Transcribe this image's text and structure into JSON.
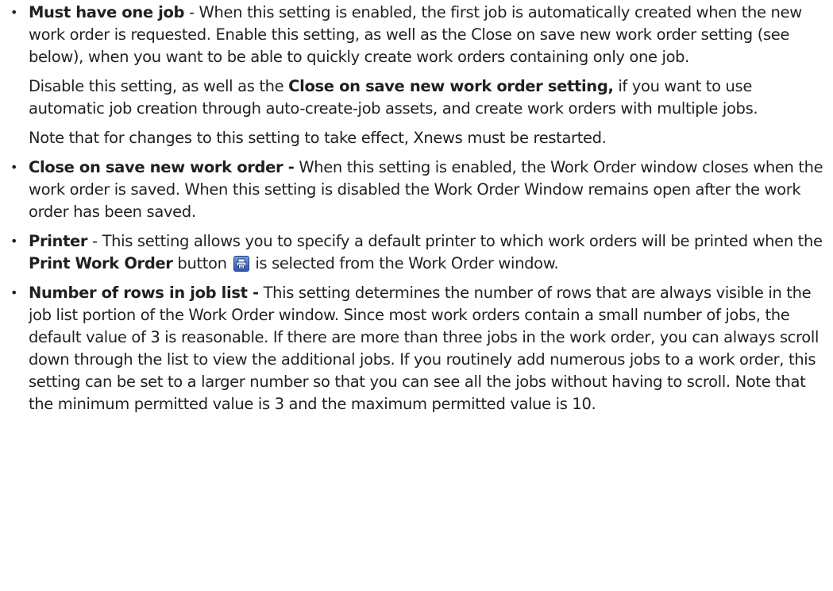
{
  "items": [
    {
      "term": "Must have one job",
      "text": " - When this setting is enabled, the first job is automatically created when the new work order is requested. Enable this setting, as well as the Close on save new work order setting (see below), when you want to be able to quickly create work orders containing only one job.",
      "p2_before": "Disable this setting, as well as the ",
      "p2_bold": "Close on save new work order setting,",
      "p2_after": " if you want to use automatic job creation through auto-create-job assets, and create work orders with multiple jobs.",
      "p3": "Note that for changes to this setting to take effect, Xnews must be restarted."
    },
    {
      "term": "Close on save new work order -",
      "text": " When this setting is enabled, the Work Order window closes when the work order is saved. When this setting is disabled the Work Order Window remains open after the work order has been saved."
    },
    {
      "term": "Printer",
      "text_before": " - This setting allows you to specify a default printer to which work orders will be printed when the ",
      "button_label": "Print Work Order",
      "text_mid": " button ",
      "text_after": " is selected from the Work Order window.",
      "icon": "printer-icon"
    },
    {
      "term": "Number of rows in job list -",
      "text": " This setting determines the number of rows that are always visible in the job list portion of the Work Order window. Since most work orders contain a small number of jobs, the default value of 3 is reasonable. If there are more than three jobs in the work order, you can always scroll down through the list to view the additional jobs. If you routinely add numerous jobs to a work order, this setting can be set to a larger number so that you can see all the jobs without having to scroll. Note that the minimum permitted value is 3 and the maximum permitted value is 10."
    }
  ],
  "bullet_char": "•",
  "colors": {
    "text": "#231f20",
    "icon_top": "#7a9bd6",
    "icon_bottom": "#2f57b0"
  }
}
